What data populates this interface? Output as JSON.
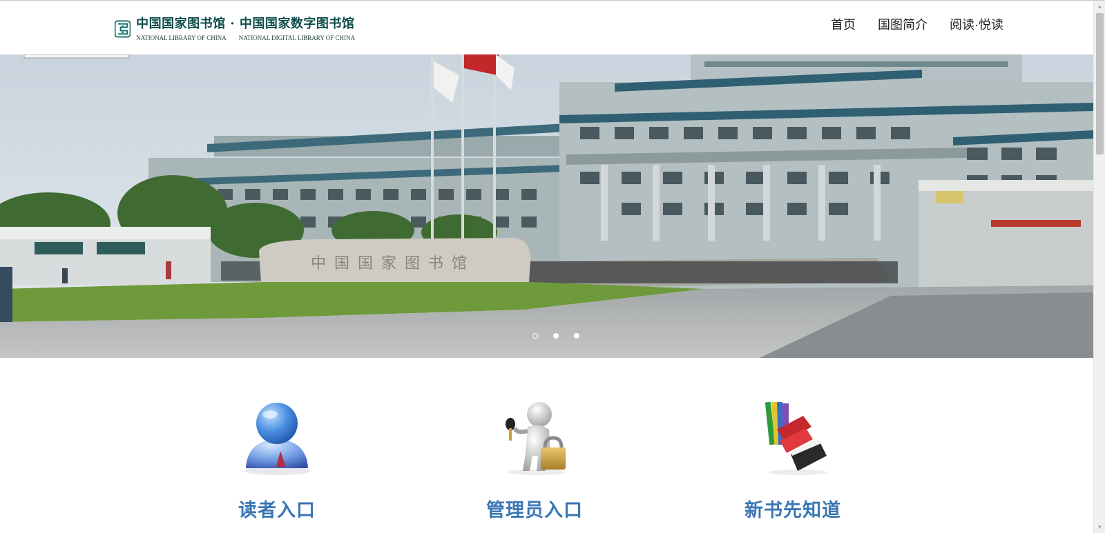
{
  "header": {
    "logo": {
      "cn_title": "中国国家图书馆 · 中国国家数字图书馆",
      "en_left": "NATIONAL LIBRARY OF CHINA",
      "en_right": "NATIONAL DIGITAL  LIBRARY OF CHINA"
    },
    "nav": [
      {
        "label": "首页"
      },
      {
        "label": "国图简介"
      },
      {
        "label": "阅读·悦读"
      }
    ]
  },
  "banner": {
    "carousel_count": 3,
    "active_index": 0,
    "stone_text": "中国国家图书馆"
  },
  "entries": [
    {
      "label": "读者入口",
      "icon": "user-icon"
    },
    {
      "label": "管理员入口",
      "icon": "admin-lock-icon"
    },
    {
      "label": "新书先知道",
      "icon": "books-icon"
    }
  ],
  "colors": {
    "logo": "#0e4d4a",
    "entry_label": "#3a76b4",
    "nav_text": "#222222"
  }
}
